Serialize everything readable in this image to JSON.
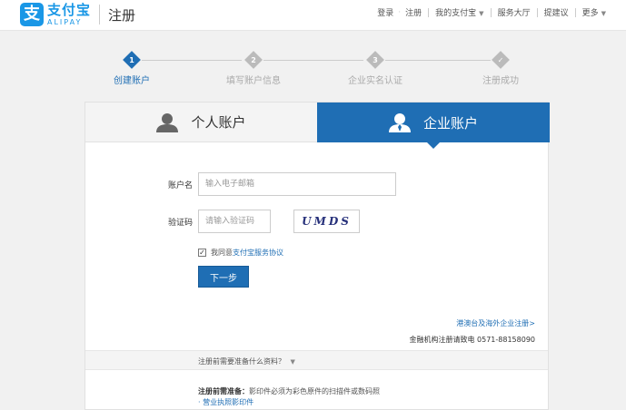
{
  "header": {
    "logo_mark": "支",
    "logo_cn": "支付宝",
    "logo_en": "ALIPAY",
    "page_title": "注册",
    "nav": {
      "login": "登录",
      "register": "注册",
      "my_alipay": "我的支付宝",
      "service_hall": "服务大厅",
      "suggest": "提建议",
      "more": "更多"
    }
  },
  "steps": [
    {
      "num": "1",
      "label": "创建账户",
      "active": true
    },
    {
      "num": "2",
      "label": "填写账户信息",
      "active": false
    },
    {
      "num": "3",
      "label": "企业实名认证",
      "active": false
    },
    {
      "num": "✓",
      "label": "注册成功",
      "active": false
    }
  ],
  "tabs": {
    "personal": "个人账户",
    "enterprise": "企业账户"
  },
  "form": {
    "account_label": "账户名",
    "account_placeholder": "输入电子邮箱",
    "captcha_label": "验证码",
    "captcha_placeholder": "请输入验证码",
    "captcha_text": "UMDS",
    "agree_text": "我同意",
    "agree_link": "支付宝服务协议",
    "next_button": "下一步"
  },
  "links": {
    "hk_link": "港澳台及海外企业注册>",
    "fin_label": "金融机构注册请致电",
    "fin_phone": "0571-88158090"
  },
  "prep": {
    "title": "注册前需要准备什么资料？",
    "note_label": "注册前需准备：",
    "note_text": "影印件必须为彩色原件的扫描件或数码照",
    "item_1": "· 营业执照影印件"
  },
  "colors": {
    "brand": "#1a97e6",
    "primary": "#1f6eb4"
  },
  "icons": [
    "person-icon",
    "enterprise-user-icon",
    "check-icon",
    "caret-down-icon"
  ]
}
